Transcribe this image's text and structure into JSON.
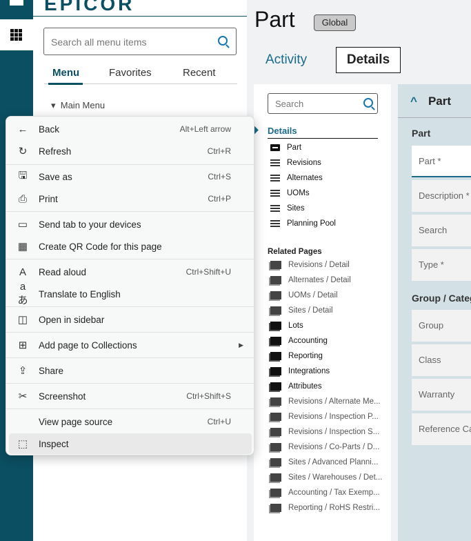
{
  "app": {
    "logo": "EPICOR"
  },
  "menu_panel": {
    "search_placeholder": "Search all menu items",
    "tabs": [
      "Menu",
      "Favorites",
      "Recent"
    ],
    "tree_root": "Main Menu"
  },
  "page": {
    "title": "Part",
    "badge": "Global",
    "tabs": [
      "Activity",
      "Details"
    ]
  },
  "nav": {
    "search_placeholder": "Search",
    "section": "Details",
    "items": [
      {
        "label": "Part",
        "icon": "card-icon"
      },
      {
        "label": "Revisions",
        "icon": "list-icon"
      },
      {
        "label": "Alternates",
        "icon": "list-icon"
      },
      {
        "label": "UOMs",
        "icon": "list-icon"
      },
      {
        "label": "Sites",
        "icon": "list-icon"
      },
      {
        "label": "Planning Pool",
        "icon": "list-icon"
      }
    ],
    "related_header": "Related Pages",
    "related": [
      "Revisions / Detail",
      "Alternates / Detail",
      "UOMs / Detail",
      "Sites / Detail",
      "Lots",
      "Accounting",
      "Reporting",
      "Integrations",
      "Attributes",
      "Revisions / Alternate Me...",
      "Revisions / Inspection P...",
      "Revisions / Inspection S...",
      "Revisions / Co-Parts / D...",
      "Sites / Advanced Planni...",
      "Sites / Warehouses / Det...",
      "Accounting / Tax Exemp...",
      "Reporting / RoHS Restri..."
    ]
  },
  "form": {
    "header": "Part",
    "group1": "Part",
    "fields1": [
      "Part *",
      "Description *",
      "Search",
      "Type *"
    ],
    "group2": "Group / Catego",
    "fields2": [
      "Group",
      "Class",
      "Warranty",
      "Reference Ca"
    ]
  },
  "context_menu": [
    {
      "label": "Back",
      "shortcut": "Alt+Left arrow",
      "icon": "←"
    },
    {
      "label": "Refresh",
      "shortcut": "Ctrl+R",
      "icon": "↻"
    },
    {
      "label": "Save as",
      "shortcut": "Ctrl+S",
      "icon": "🖫"
    },
    {
      "label": "Print",
      "shortcut": "Ctrl+P",
      "icon": "⎙"
    },
    {
      "label": "Send tab to your devices",
      "shortcut": "",
      "icon": "▭"
    },
    {
      "label": "Create QR Code for this page",
      "shortcut": "",
      "icon": "▦"
    },
    {
      "label": "Read aloud",
      "shortcut": "Ctrl+Shift+U",
      "icon": "A"
    },
    {
      "label": "Translate to English",
      "shortcut": "",
      "icon": "aあ"
    },
    {
      "label": "Open in sidebar",
      "shortcut": "",
      "icon": "◫"
    },
    {
      "label": "Add page to Collections",
      "shortcut": "",
      "icon": "⊞",
      "submenu": "▶"
    },
    {
      "label": "Share",
      "shortcut": "",
      "icon": "⇪"
    },
    {
      "label": "Screenshot",
      "shortcut": "Ctrl+Shift+S",
      "icon": "✂"
    },
    {
      "label": "View page source",
      "shortcut": "Ctrl+U",
      "icon": ""
    },
    {
      "label": "Inspect",
      "shortcut": "",
      "icon": "⬚"
    }
  ]
}
